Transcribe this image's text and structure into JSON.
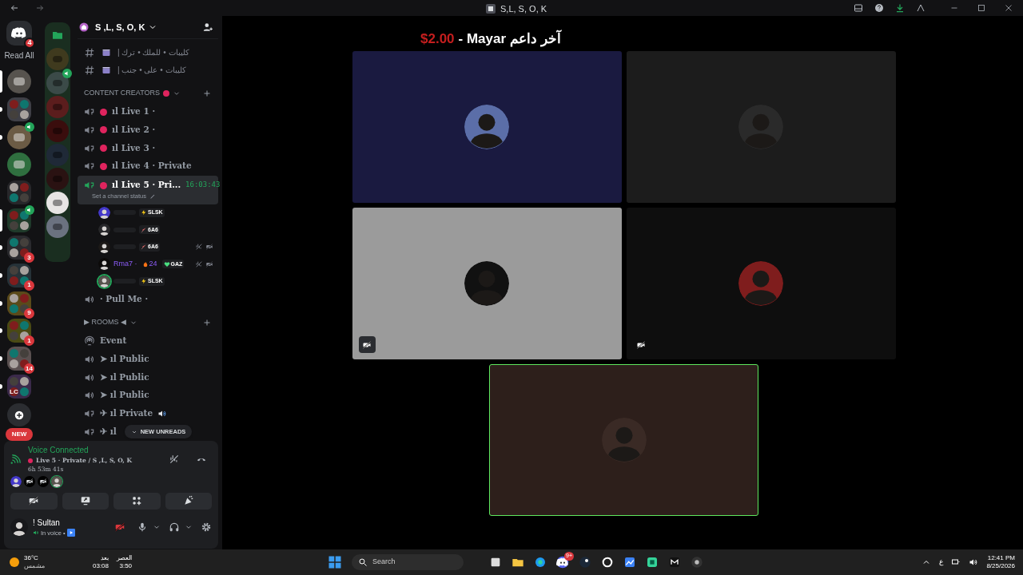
{
  "window": {
    "title": "S,L, S, O, K"
  },
  "rail": {
    "dm_badge": "4",
    "read_all": "Read All",
    "items": [
      {
        "kind": "server",
        "selected": true,
        "unread": false
      },
      {
        "kind": "folder",
        "selected": false,
        "unread": true
      },
      {
        "kind": "server",
        "selected": false,
        "unread": true,
        "speaker": true
      },
      {
        "kind": "server",
        "selected": false,
        "unread": false
      },
      {
        "kind": "folder",
        "selected": false,
        "unread": false
      },
      {
        "kind": "folder",
        "selected": true,
        "unread": false,
        "speaker": true
      },
      {
        "kind": "folder",
        "selected": false,
        "unread": true,
        "badge": "3"
      },
      {
        "kind": "folder",
        "selected": false,
        "unread": true,
        "badge": "1"
      },
      {
        "kind": "folder",
        "selected": false,
        "unread": true,
        "badge": "9"
      },
      {
        "kind": "folder",
        "selected": false,
        "unread": true,
        "badge": "1"
      },
      {
        "kind": "folder",
        "selected": false,
        "unread": true,
        "badge": "14"
      },
      {
        "kind": "folder",
        "selected": false,
        "unread": true,
        "label": "LC"
      }
    ],
    "new_label": "NEW"
  },
  "folder_servers": [
    {
      "speaker": false
    },
    {
      "speaker": true
    },
    {
      "speaker": false
    },
    {
      "speaker": false
    },
    {
      "speaker": false
    },
    {
      "speaker": false
    },
    {
      "speaker": false
    },
    {
      "speaker": false
    }
  ],
  "server": {
    "name": "S ,L, S, O, K"
  },
  "channels": [
    {
      "kind": "text",
      "label": "| كليبات • للملك • ترك"
    },
    {
      "kind": "text",
      "label": "| كليبات • على • جنب"
    },
    {
      "kind": "category",
      "label": "CONTENT CREATORS",
      "collapsed": false
    },
    {
      "kind": "limited",
      "live": true,
      "label": "ıl Live 1 ·",
      "selected": false
    },
    {
      "kind": "limited",
      "live": true,
      "label": "ıl Live 2 ·",
      "selected": false
    },
    {
      "kind": "limited",
      "live": true,
      "label": "ıl Live 3 ·",
      "selected": false
    },
    {
      "kind": "limited",
      "live": true,
      "label": "ıl Live 4 · Private",
      "selected": false
    },
    {
      "kind": "limited",
      "live": true,
      "label": "ıl Live 5 · Pri...",
      "selected": true,
      "time": "16:03:43",
      "status": "Set a channel status"
    },
    {
      "kind": "member",
      "speaking": false,
      "muted": false,
      "badges": [
        {
          "kind": "bolt",
          "text": "SLSK",
          "boxed": true
        }
      ]
    },
    {
      "kind": "member",
      "speaking": false,
      "muted": false,
      "badges": [
        {
          "kind": "rocket",
          "text": "6A6",
          "boxed": true
        }
      ]
    },
    {
      "kind": "member",
      "speaking": false,
      "muted": true,
      "badges": [
        {
          "kind": "rocket",
          "text": "6A6",
          "boxed": true
        }
      ]
    },
    {
      "kind": "member",
      "name": "Rma7 ·",
      "speaking": false,
      "muted": true,
      "badges": [
        {
          "kind": "fire",
          "text": "24",
          "boxed": false
        },
        {
          "kind": "heart",
          "text": "GAZ",
          "boxed": true
        }
      ]
    },
    {
      "kind": "member",
      "speaking": true,
      "muted": false,
      "badges": [
        {
          "kind": "bolt",
          "text": "SLSK",
          "boxed": true
        }
      ]
    },
    {
      "kind": "voice",
      "live": false,
      "label": "· Pull Me ·",
      "selected": false
    },
    {
      "kind": "category",
      "label": "▶ ROOMS ◀",
      "collapsed": false
    },
    {
      "kind": "stage",
      "label": "Event"
    },
    {
      "kind": "voice",
      "live": false,
      "label": "➤ ıl Public",
      "selected": false
    },
    {
      "kind": "voice",
      "live": false,
      "label": "➤ ıl Public",
      "selected": false
    },
    {
      "kind": "voice",
      "live": false,
      "label": "➤ ıl Public",
      "selected": false
    },
    {
      "kind": "limited",
      "live": false,
      "label": "✈ ıl Private",
      "selected": false,
      "speaker": true
    },
    {
      "kind": "limited",
      "live": false,
      "label": "✈ ıl",
      "selected": false,
      "speaker": false
    }
  ],
  "new_unreads": "NEW UNREADS",
  "voice_panel": {
    "title": "Voice Connected",
    "channel": "Live 5 · Private / S ,L, S, O, K",
    "duration": "6h 53m 41s",
    "participants": [
      {
        "kind": "avatar"
      },
      {
        "kind": "video_off"
      },
      {
        "kind": "video_off"
      },
      {
        "kind": "avatar"
      }
    ]
  },
  "user": {
    "name": "! Sultan",
    "status": "In voice •"
  },
  "stage": {
    "banner": {
      "text": "آخر داعم Mayar -",
      "amount": "$2.00"
    },
    "tiles": [
      {
        "color": "#1a1a40",
        "speaking": false,
        "video_off": false
      },
      {
        "color": "#1c1c1c",
        "speaking": false,
        "video_off": false
      },
      {
        "color": "#9b9b9b",
        "speaking": false,
        "video_off": true,
        "icon_box": true
      },
      {
        "color": "#0e0e0e",
        "speaking": false,
        "video_off": true,
        "icon_box": false
      },
      {
        "color": "#2d1f1b",
        "speaking": true,
        "video_off": false
      }
    ]
  },
  "taskbar": {
    "temp": "36°C",
    "weather": "مشمس",
    "prayer": "العصر",
    "prayer_time": "3:50",
    "after": "بعد",
    "countdown": "03:08",
    "search": "Search",
    "discord_badge": "9+",
    "lang": "ع",
    "time": "12:41 PM",
    "date": "8/25/2026"
  }
}
